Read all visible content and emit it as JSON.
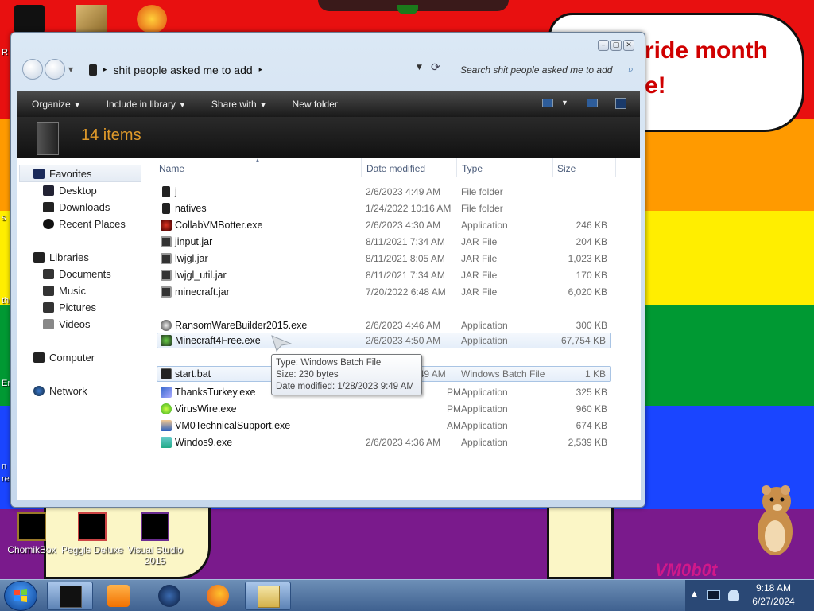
{
  "desktop": {
    "banner_line1": "ride month",
    "banner_line2": "e!",
    "edge_texts": [
      "R",
      "s",
      "th",
      "Er",
      "n",
      "re"
    ],
    "icons": [
      {
        "label": "ChomikBox"
      },
      {
        "label": "Peggle Deluxe"
      },
      {
        "label": "Visual Studio 2015"
      }
    ],
    "vm_logo": "VM0b0t"
  },
  "window": {
    "address_path": "shit people asked me to add",
    "search_placeholder": "Search shit people asked me to add",
    "toolbar": {
      "organize": "Organize",
      "include_in_library": "Include in library",
      "share_with": "Share with",
      "new_folder": "New folder"
    },
    "item_count": "14 items",
    "nav": {
      "favorites": "Favorites",
      "desktop": "Desktop",
      "downloads": "Downloads",
      "recent_places": "Recent Places",
      "libraries": "Libraries",
      "documents": "Documents",
      "music": "Music",
      "pictures": "Pictures",
      "videos": "Videos",
      "computer": "Computer",
      "network": "Network"
    },
    "columns": {
      "name": "Name",
      "date": "Date modified",
      "type": "Type",
      "size": "Size"
    },
    "files": [
      {
        "name": "j",
        "date": "2/6/2023 4:49 AM",
        "type": "File folder",
        "size": ""
      },
      {
        "name": "natives",
        "date": "1/24/2022 10:16 AM",
        "type": "File folder",
        "size": ""
      },
      {
        "name": "CollabVMBotter.exe",
        "date": "2/6/2023 4:30 AM",
        "type": "Application",
        "size": "246 KB"
      },
      {
        "name": "jinput.jar",
        "date": "8/11/2021 7:34 AM",
        "type": "JAR File",
        "size": "204 KB"
      },
      {
        "name": "lwjgl.jar",
        "date": "8/11/2021 8:05 AM",
        "type": "JAR File",
        "size": "1,023 KB"
      },
      {
        "name": "lwjgl_util.jar",
        "date": "8/11/2021 7:34 AM",
        "type": "JAR File",
        "size": "170 KB"
      },
      {
        "name": "minecraft.jar",
        "date": "7/20/2022 6:48 AM",
        "type": "JAR File",
        "size": "6,020 KB"
      },
      {
        "name": "Minecraft4Free.exe",
        "date": "2/6/2023 4:50 AM",
        "type": "Application",
        "size": "67,754 KB"
      },
      {
        "name": "RansomWareBuilder2015.exe",
        "date": "2/6/2023 4:46 AM",
        "type": "Application",
        "size": "300 KB"
      },
      {
        "name": "start.bat",
        "date": "1/28/2023 9:49 AM",
        "type": "Windows Batch File",
        "size": "1 KB"
      },
      {
        "name": "ThanksTurkey.exe",
        "date": "PM",
        "type": "Application",
        "size": "325 KB"
      },
      {
        "name": "VirusWire.exe",
        "date": "PM",
        "type": "Application",
        "size": "960 KB"
      },
      {
        "name": "VM0TechnicalSupport.exe",
        "date": "AM",
        "type": "Application",
        "size": "674 KB"
      },
      {
        "name": "Windos9.exe",
        "date": "2/6/2023 4:36 AM",
        "type": "Application",
        "size": "2,539 KB"
      }
    ],
    "tooltip": {
      "type": "Type: Windows Batch File",
      "size": "Size: 230 bytes",
      "date": "Date modified: 1/28/2023 9:49 AM"
    }
  },
  "taskbar": {
    "time": "9:18 AM",
    "date": "6/27/2024"
  }
}
